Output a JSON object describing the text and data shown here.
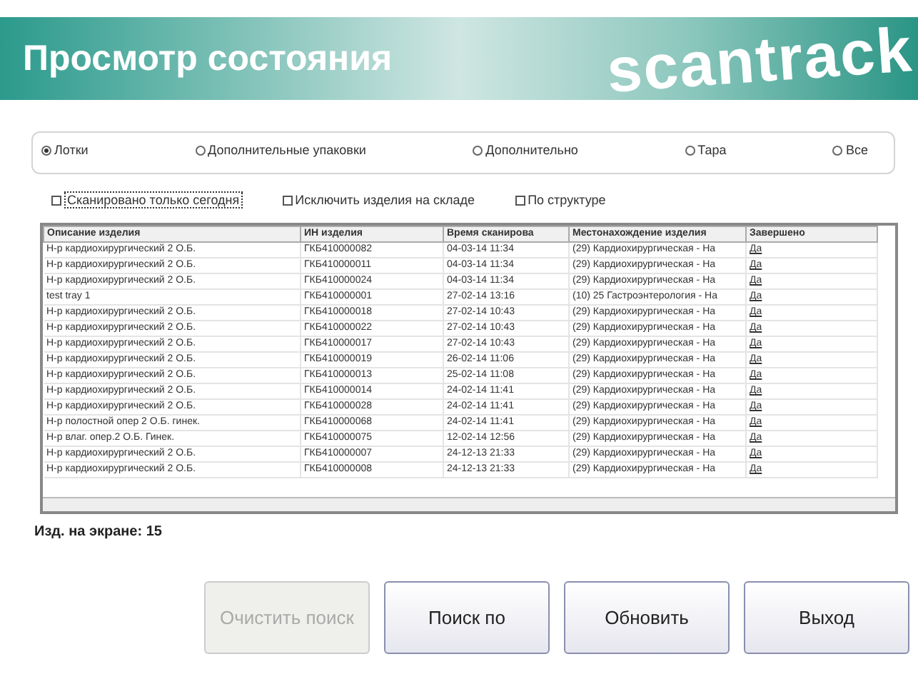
{
  "header": {
    "title": "Просмотр состояния",
    "logo": "scantrack"
  },
  "filters": [
    {
      "label": "Лотки",
      "selected": true
    },
    {
      "label": "Дополнительные упаковки",
      "selected": false
    },
    {
      "label": "Дополнительно",
      "selected": false
    },
    {
      "label": "Тара",
      "selected": false
    },
    {
      "label": "Все",
      "selected": false
    }
  ],
  "options": [
    {
      "label": "Сканировано только сегодня",
      "checked": false,
      "focused": true
    },
    {
      "label": "Исключить изделия на складе",
      "checked": false,
      "focused": false
    },
    {
      "label": "По структуре",
      "checked": false,
      "focused": false
    }
  ],
  "table": {
    "columns": [
      "Описание изделия",
      "ИН изделия",
      "Время сканирова",
      "Местонахождение изделия",
      "Завершено"
    ],
    "rows": [
      [
        "Н-р кардиохирургический 2 О.Б.",
        "ГКБ410000082",
        "04-03-14 11:34",
        "(29) Кардиохирургическая - На",
        "Да"
      ],
      [
        "Н-р кардиохирургический 2 О.Б.",
        "ГКБ410000011",
        "04-03-14 11:34",
        "(29) Кардиохирургическая - На",
        "Да"
      ],
      [
        "Н-р кардиохирургический 2 О.Б.",
        "ГКБ410000024",
        "04-03-14 11:34",
        "(29) Кардиохирургическая - На",
        "Да"
      ],
      [
        "test tray 1",
        "ГКБ410000001",
        "27-02-14 13:16",
        "(10) 25 Гастроэнтерология - На",
        "Да"
      ],
      [
        "Н-р кардиохирургический 2 О.Б.",
        "ГКБ410000018",
        "27-02-14 10:43",
        "(29) Кардиохирургическая - На",
        "Да"
      ],
      [
        "Н-р кардиохирургический 2 О.Б.",
        "ГКБ410000022",
        "27-02-14 10:43",
        "(29) Кардиохирургическая - На",
        "Да"
      ],
      [
        "Н-р кардиохирургический 2 О.Б.",
        "ГКБ410000017",
        "27-02-14 10:43",
        "(29) Кардиохирургическая - На",
        "Да"
      ],
      [
        "Н-р кардиохирургический 2 О.Б.",
        "ГКБ410000019",
        "26-02-14 11:06",
        "(29) Кардиохирургическая - На",
        "Да"
      ],
      [
        "Н-р кардиохирургический 2 О.Б.",
        "ГКБ410000013",
        "25-02-14 11:08",
        "(29) Кардиохирургическая - На",
        "Да"
      ],
      [
        "Н-р кардиохирургический 2 О.Б.",
        "ГКБ410000014",
        "24-02-14 11:41",
        "(29) Кардиохирургическая - На",
        "Да"
      ],
      [
        "Н-р кардиохирургический 2 О.Б.",
        "ГКБ410000028",
        "24-02-14 11:41",
        "(29) Кардиохирургическая - На",
        "Да"
      ],
      [
        "Н-р полостной опер 2 О.Б. гинек.",
        "ГКБ410000068",
        "24-02-14 11:41",
        "(29) Кардиохирургическая - На",
        "Да"
      ],
      [
        "Н-р влаг. опер.2 О.Б. Гинек.",
        "ГКБ410000075",
        "12-02-14 12:56",
        "(29) Кардиохирургическая - На",
        "Да"
      ],
      [
        "Н-р кардиохирургический 2 О.Б.",
        "ГКБ410000007",
        "24-12-13 21:33",
        "(29) Кардиохирургическая - На",
        "Да"
      ],
      [
        "Н-р кардиохирургический 2 О.Б.",
        "ГКБ410000008",
        "24-12-13 21:33",
        "(29) Кардиохирургическая - На",
        "Да"
      ]
    ]
  },
  "count": "Изд. на экране: 15",
  "buttons": [
    {
      "label": "Очистить поиск",
      "disabled": true
    },
    {
      "label": "Поиск по",
      "disabled": false
    },
    {
      "label": "Обновить",
      "disabled": false
    },
    {
      "label": "Выход",
      "disabled": false
    }
  ]
}
